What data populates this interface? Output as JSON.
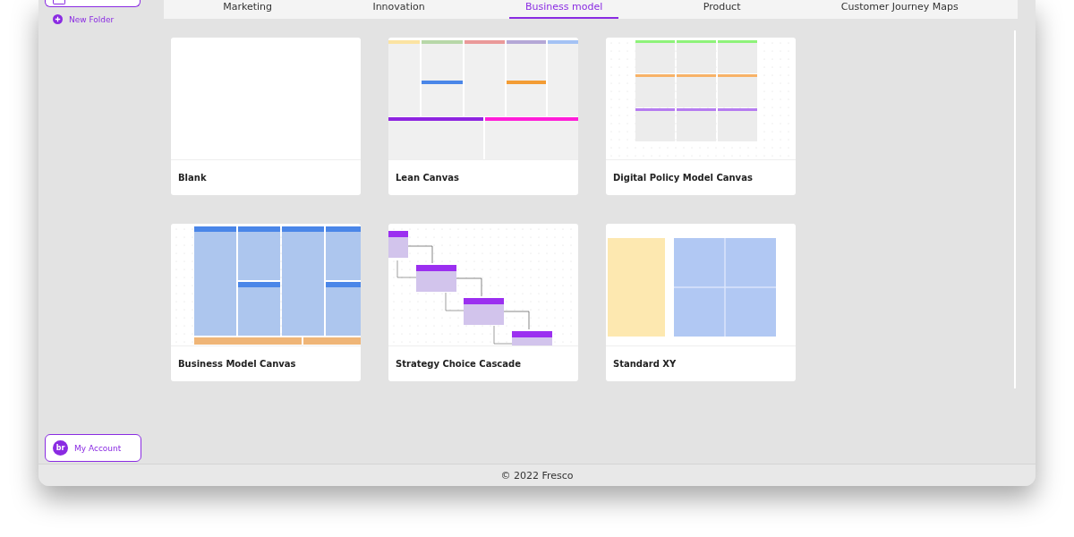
{
  "sidebar": {
    "new_folder": "New Folder",
    "account": {
      "initials": "br",
      "label": "My Account"
    }
  },
  "tabs": [
    {
      "label": "Marketing",
      "selected": false
    },
    {
      "label": "Innovation",
      "selected": false
    },
    {
      "label": "Business model",
      "selected": true
    },
    {
      "label": "Product",
      "selected": false
    },
    {
      "label": "Customer Journey Maps",
      "selected": false
    }
  ],
  "templates": [
    {
      "name": "Blank",
      "kind": "blank"
    },
    {
      "name": "Lean Canvas",
      "kind": "lean"
    },
    {
      "name": "Digital Policy Model Canvas",
      "kind": "grid"
    },
    {
      "name": "Business Model Canvas",
      "kind": "bmc"
    },
    {
      "name": "Strategy Choice Cascade",
      "kind": "cascade"
    },
    {
      "name": "Standard XY",
      "kind": "xy"
    }
  ],
  "footer": "© 2022 Fresco"
}
